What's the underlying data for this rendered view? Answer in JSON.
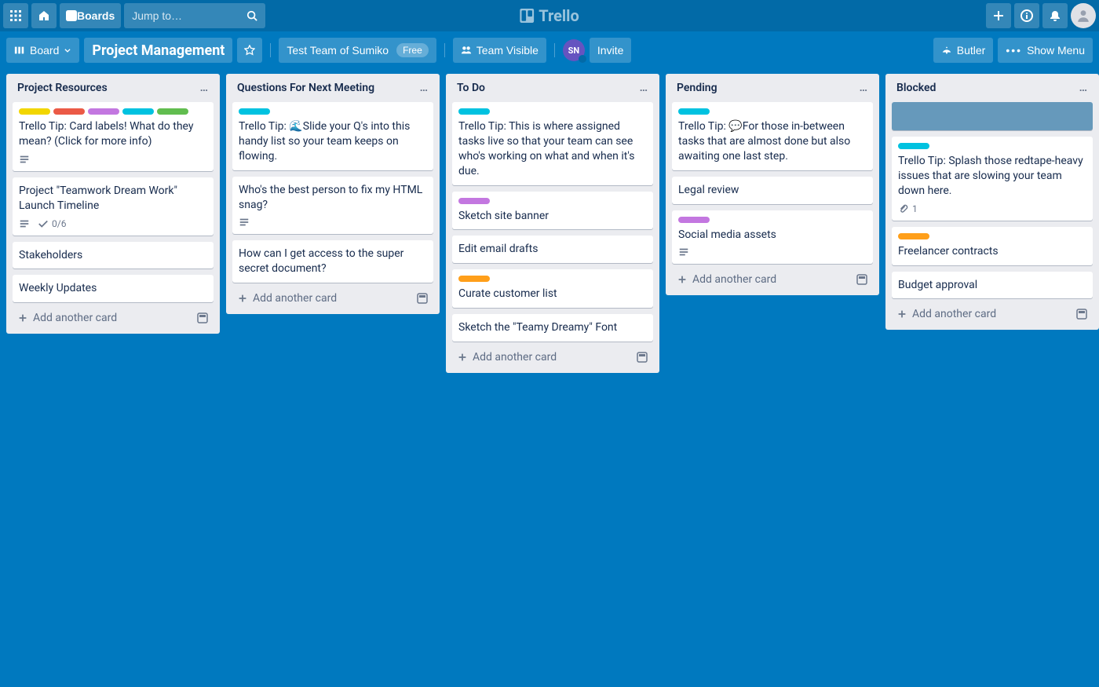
{
  "header": {
    "boards_label": "Boards",
    "search_placeholder": "Jump to…",
    "logo_text": "Trello"
  },
  "boardbar": {
    "view_label": "Board",
    "title": "Project Management",
    "team_label": "Test Team of Sumiko",
    "team_pill": "Free",
    "visibility": "Team Visible",
    "member_initials": "SN",
    "invite": "Invite",
    "butler": "Butler",
    "show_menu": "Show Menu"
  },
  "add_card_label": "Add another card",
  "lists": [
    {
      "title": "Project Resources",
      "cards": [
        {
          "labels": [
            "yellow",
            "red",
            "purple",
            "sky",
            "green"
          ],
          "text": "Trello Tip: Card labels! What do they mean? (Click for more info)",
          "badges": [
            {
              "type": "desc"
            }
          ]
        },
        {
          "text": "Project \"Teamwork Dream Work\" Launch Timeline",
          "badges": [
            {
              "type": "desc"
            },
            {
              "type": "checklist",
              "text": "0/6"
            }
          ]
        },
        {
          "text": "Stakeholders"
        },
        {
          "text": "Weekly Updates"
        }
      ]
    },
    {
      "title": "Questions For Next Meeting",
      "cards": [
        {
          "labels": [
            "sky"
          ],
          "text": "Trello Tip: 🌊Slide your Q's into this handy list so your team keeps on flowing."
        },
        {
          "text": "Who's the best person to fix my HTML snag?",
          "badges": [
            {
              "type": "desc"
            }
          ]
        },
        {
          "text": "How can I get access to the super secret document?"
        }
      ]
    },
    {
      "title": "To Do",
      "cards": [
        {
          "labels": [
            "sky"
          ],
          "text": "Trello Tip: This is where assigned tasks live so that your team can see who's working on what and when it's due."
        },
        {
          "labels": [
            "purple"
          ],
          "text": "Sketch site banner"
        },
        {
          "text": "Edit email drafts"
        },
        {
          "labels": [
            "orange"
          ],
          "text": "Curate customer list"
        },
        {
          "text": "Sketch the \"Teamy Dreamy\" Font"
        }
      ]
    },
    {
      "title": "Pending",
      "cards": [
        {
          "labels": [
            "sky"
          ],
          "text": "Trello Tip: 💬For those in-between tasks that are almost done but also awaiting one last step."
        },
        {
          "text": "Legal review"
        },
        {
          "labels": [
            "purple"
          ],
          "text": "Social media assets",
          "badges": [
            {
              "type": "desc"
            }
          ]
        }
      ]
    },
    {
      "title": "Blocked",
      "cards": [
        {
          "placeholder": true
        },
        {
          "labels": [
            "sky"
          ],
          "text": "Trello Tip: Splash those redtape-heavy issues that are slowing your team down here.",
          "badges": [
            {
              "type": "attach",
              "text": "1"
            }
          ]
        },
        {
          "labels": [
            "orange"
          ],
          "text": "Freelancer contracts"
        },
        {
          "text": "Budget approval"
        }
      ]
    }
  ]
}
